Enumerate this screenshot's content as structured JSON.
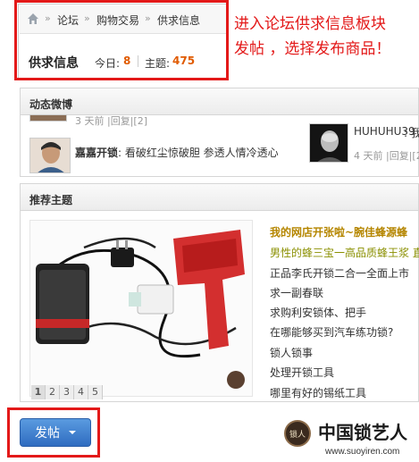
{
  "breadcrumb": {
    "items": [
      "论坛",
      "购物交易",
      "供求信息"
    ],
    "separator": "»"
  },
  "forum": {
    "name": "供求信息",
    "today_label": "今日:",
    "today_count": "8",
    "topics_label": "主题:",
    "topics_count": "475"
  },
  "annotation": {
    "line1": "进入论坛供求信息板块",
    "line2": "发帖 ，选择发布商品！"
  },
  "weibo": {
    "title": "动态微博",
    "top_meta": "3 天前 |回复|[2]",
    "entry1": {
      "author": "嘉嘉开锁",
      "text": ": 看破红尘惊破胆 参透人情冷透心"
    },
    "entry2": {
      "author": "HUHUHU39",
      "text": ": 我",
      "meta": "4 天前 |回复|[2]"
    }
  },
  "recommended": {
    "title": "推荐主题",
    "pages": [
      "1",
      "2",
      "3",
      "4",
      "5"
    ],
    "items": [
      "我的网店开张啦~腕佳蜂源蜂",
      "男性的蜂三宝一高品质蜂王浆 直",
      "正品李氏开锁二合一全面上市",
      "求一副春联",
      "求购利安锁体、把手",
      "在哪能够买到汽车练功锁?",
      "锁人锁事",
      "处理开锁工具",
      "哪里有好的锡纸工具"
    ]
  },
  "post_button": {
    "label": "发帖"
  },
  "watermark": {
    "badge": "锁人",
    "title": "中国锁艺人",
    "url": "www.suoyiren.com"
  },
  "colors": {
    "accent_red": "#e31919",
    "count_orange": "#e05a00",
    "headline_gold": "#b58600",
    "highlight_green": "#8a8f00",
    "button_blue": "#3a78cc"
  }
}
